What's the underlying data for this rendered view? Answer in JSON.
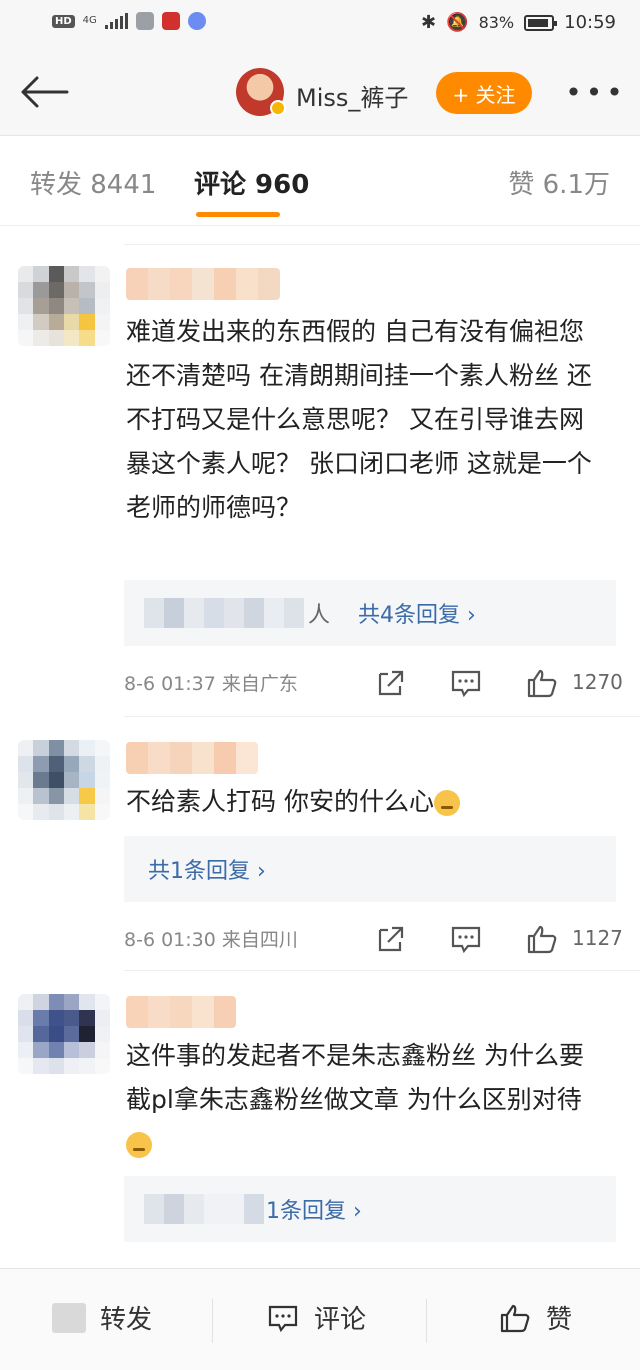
{
  "status_bar": {
    "hd": "HD",
    "network": "4G",
    "battery": "83%",
    "time": "10:59"
  },
  "header": {
    "author_name": "Miss_裤子",
    "follow_label": "+ 关注",
    "more_label": "•••"
  },
  "tabs": {
    "repost": "转发 8441",
    "comment": "评论 960",
    "like": "赞 6.1万"
  },
  "comments": [
    {
      "text": "难道发出来的东西假的 自己有没有偏袒您还不清楚吗 在清朗期间挂一个素人粉丝 还不打码又是什么意思呢？ 又在引导谁去网暴这个素人呢？ 张口闭口老师 这就是一个老师的师德吗？",
      "reply_prefix_visible": "人",
      "reply_summary": "共4条回复 ›",
      "time": "8-6 01:37",
      "source": "来自广东",
      "likes": "1270"
    },
    {
      "text": "不给素人打码 你安的什么心",
      "reply_summary": "共1条回复 ›",
      "time": "8-6 01:30",
      "source": "来自四川",
      "likes": "1127"
    },
    {
      "text": "这件事的发起者不是朱志鑫粉丝 为什么要截pl拿朱志鑫粉丝做文章 为什么区别对待",
      "reply_summary": "1条回复 ›"
    }
  ],
  "bottom_bar": {
    "repost": "转发",
    "comment": "评论",
    "like": "赞"
  },
  "colors": {
    "accent": "#ff8a00",
    "link": "#3b6ba8",
    "divider": "#eeeeee"
  }
}
